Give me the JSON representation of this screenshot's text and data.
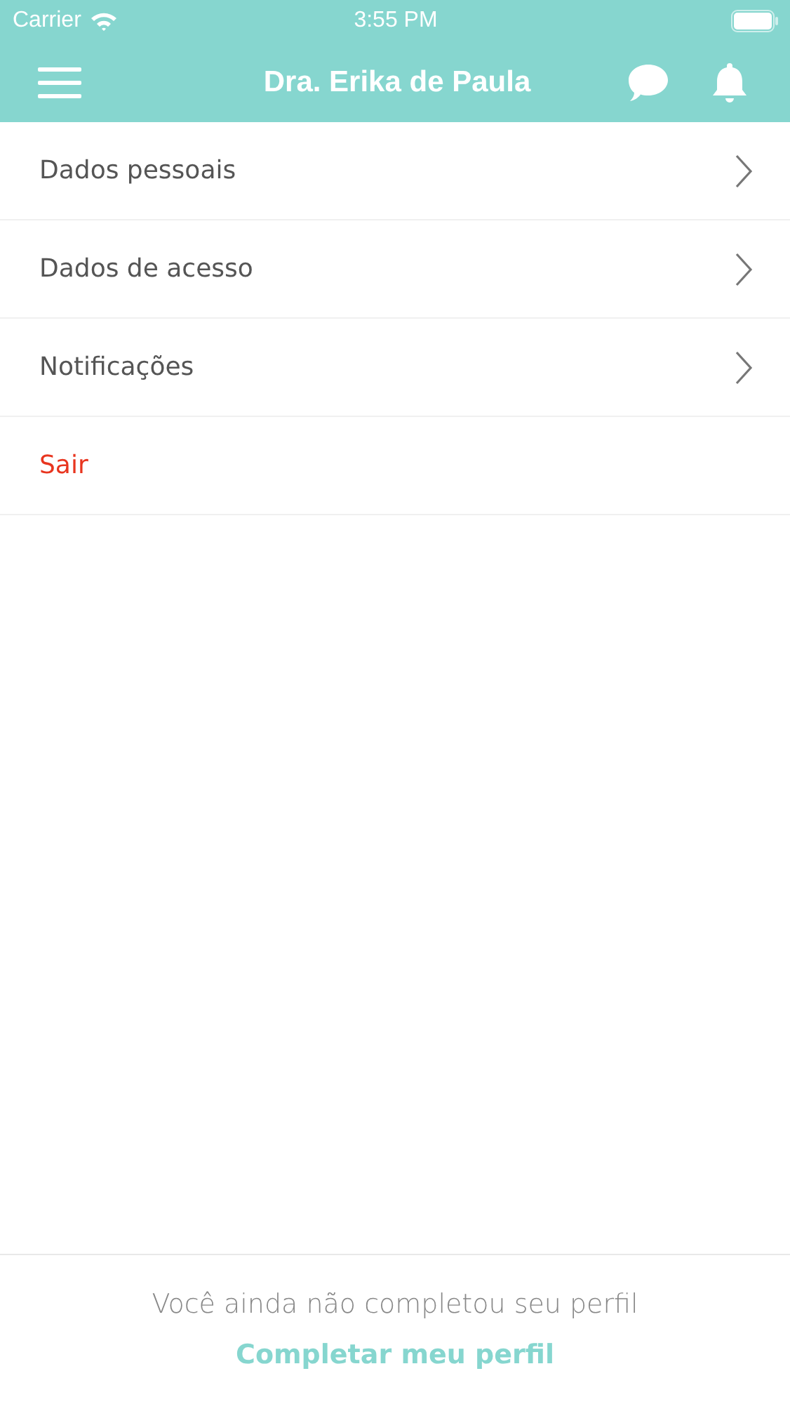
{
  "status_bar": {
    "carrier": "Carrier",
    "time": "3:55 PM"
  },
  "nav_bar": {
    "title": "Dra. Erika de Paula"
  },
  "menu": [
    {
      "label": "Dados pessoais",
      "kind": "link"
    },
    {
      "label": "Dados de acesso",
      "kind": "link"
    },
    {
      "label": "Notificações",
      "kind": "link"
    },
    {
      "label": "Sair",
      "kind": "danger"
    }
  ],
  "footer": {
    "message": "Você ainda não completou seu perfil",
    "action": "Completar meu perfil"
  }
}
